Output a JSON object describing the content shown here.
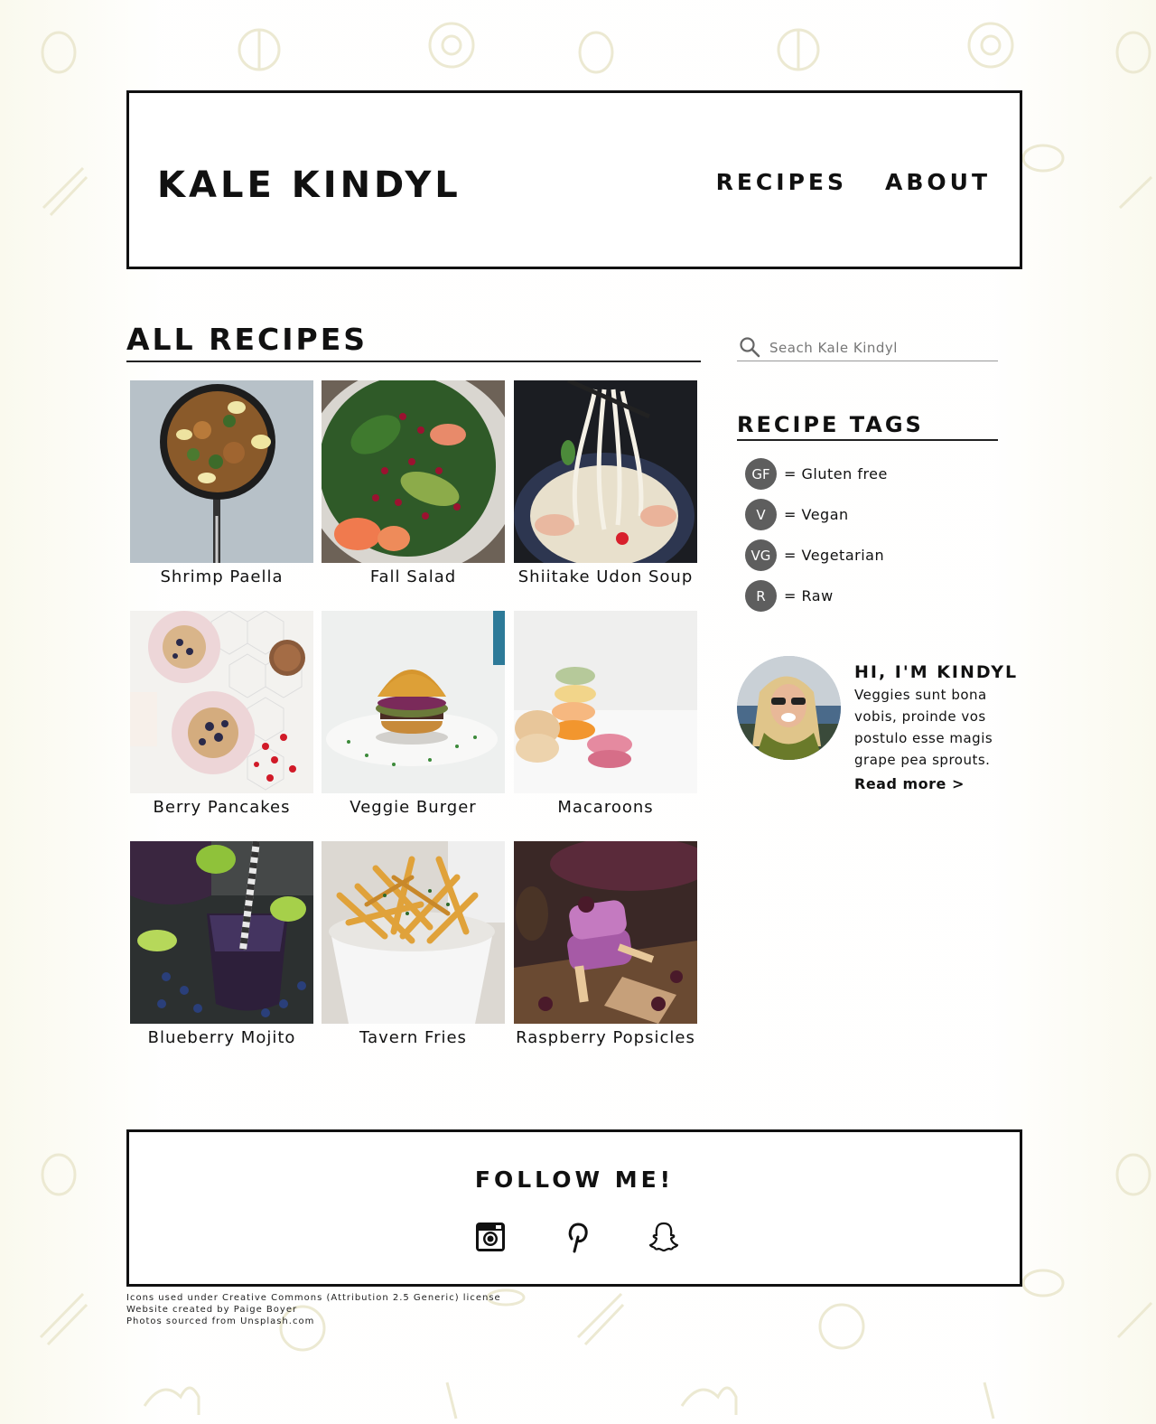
{
  "site": {
    "logo": "KALE KINDYL",
    "nav": [
      {
        "label": "RECIPES"
      },
      {
        "label": "ABOUT"
      }
    ]
  },
  "recipes_section": {
    "title": "ALL RECIPES",
    "cards": [
      {
        "caption": "Shrimp Paella",
        "image": "shrimp-paella-photo"
      },
      {
        "caption": "Fall Salad",
        "image": "fall-salad-photo"
      },
      {
        "caption": "Shiitake Udon Soup",
        "image": "udon-soup-photo"
      },
      {
        "caption": "Berry Pancakes",
        "image": "berry-pancakes-photo"
      },
      {
        "caption": "Veggie Burger",
        "image": "veggie-burger-photo"
      },
      {
        "caption": "Macaroons",
        "image": "macaroons-photo"
      },
      {
        "caption": "Blueberry Mojito",
        "image": "blueberry-mojito-photo"
      },
      {
        "caption": "Tavern Fries",
        "image": "tavern-fries-photo"
      },
      {
        "caption": "Raspberry Popsicles",
        "image": "raspberry-popsicles-photo"
      }
    ]
  },
  "sidebar": {
    "search": {
      "placeholder": "Seach Kale Kindyl",
      "value": "",
      "icon": "search-icon"
    },
    "tags_title": "RECIPE TAGS",
    "tags": [
      {
        "code": "GF",
        "label": "= Gluten free"
      },
      {
        "code": "V",
        "label": "= Vegan"
      },
      {
        "code": "VG",
        "label": "= Vegetarian"
      },
      {
        "code": "R",
        "label": "= Raw"
      }
    ],
    "about": {
      "title": "HI, I'M KINDYL",
      "body": "Veggies sunt bona vobis, proinde vos postulo esse magis grape pea sprouts.",
      "read_more": "Read more >"
    }
  },
  "footer": {
    "title": "FOLLOW ME!",
    "socials": [
      {
        "icon": "instagram-icon"
      },
      {
        "icon": "pinterest-icon"
      },
      {
        "icon": "snapchat-icon"
      }
    ],
    "credits": [
      "Icons used under Creative Commons (Attribution 2.5 Generic) license",
      "Website created by Paige Boyer",
      "Photos sourced from Unsplash.com"
    ]
  },
  "colors": {
    "background": "#faf9ee",
    "text": "#111111",
    "badge": "#5e5e5e"
  }
}
